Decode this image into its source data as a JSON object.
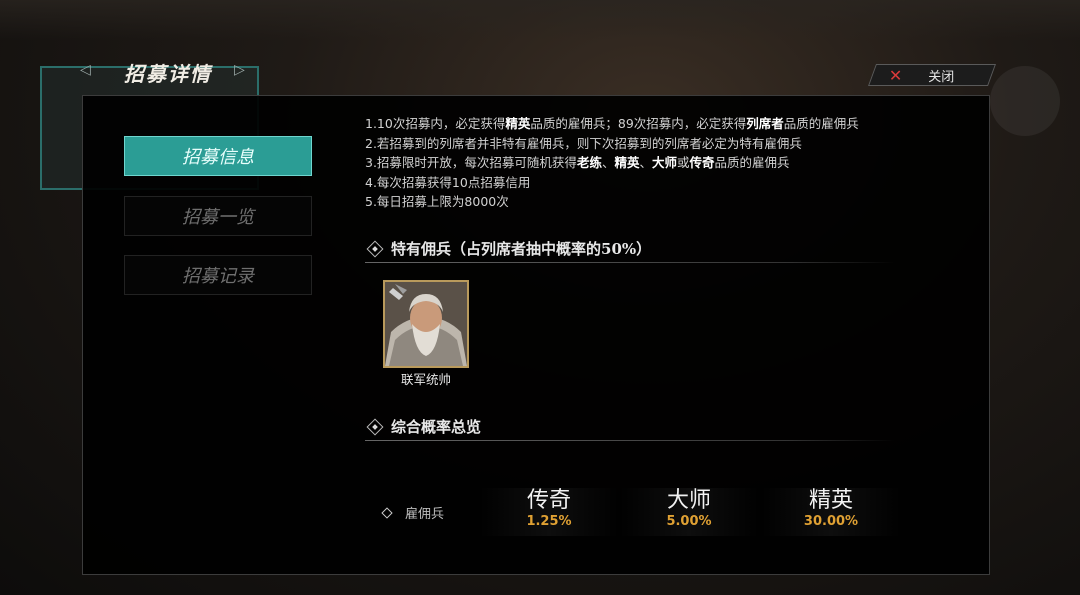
{
  "header": {
    "title": "招募详情",
    "close_label": "关闭"
  },
  "tabs": [
    {
      "label": "招募信息",
      "active": true
    },
    {
      "label": "招募一览",
      "active": false
    },
    {
      "label": "招募记录",
      "active": false
    }
  ],
  "rules": [
    [
      "1.10次招募内，必定获得",
      "精英",
      "品质的雇佣兵；89次招募内，必定获得",
      "列席者",
      "品质的雇佣兵"
    ],
    [
      "2.若招募到的列席者并非特有雇佣兵，则下次招募到的列席者必定为特有雇佣兵"
    ],
    [
      "3.招募限时开放，每次招募可随机获得",
      "老练",
      "、",
      "精英",
      "、",
      "大师",
      "或",
      "传奇",
      "品质的雇佣兵"
    ],
    [
      "4.每次招募获得10点招募信用"
    ],
    [
      "5.每日招募上限为8000次"
    ]
  ],
  "special_section": {
    "title": "特有佣兵（占列席者抽中概率的50%）",
    "mercenary_name": "联军统帅"
  },
  "overview_section": {
    "title": "综合概率总览",
    "row_label": "雇佣兵",
    "tiers": [
      {
        "name": "传奇",
        "rate": "1.25%"
      },
      {
        "name": "大师",
        "rate": "5.00%"
      },
      {
        "name": "精英",
        "rate": "30.00%"
      }
    ]
  },
  "colors": {
    "accent_teal": "#2b9d95",
    "rate_orange": "#e0a133",
    "close_red": "#d93a3a"
  }
}
